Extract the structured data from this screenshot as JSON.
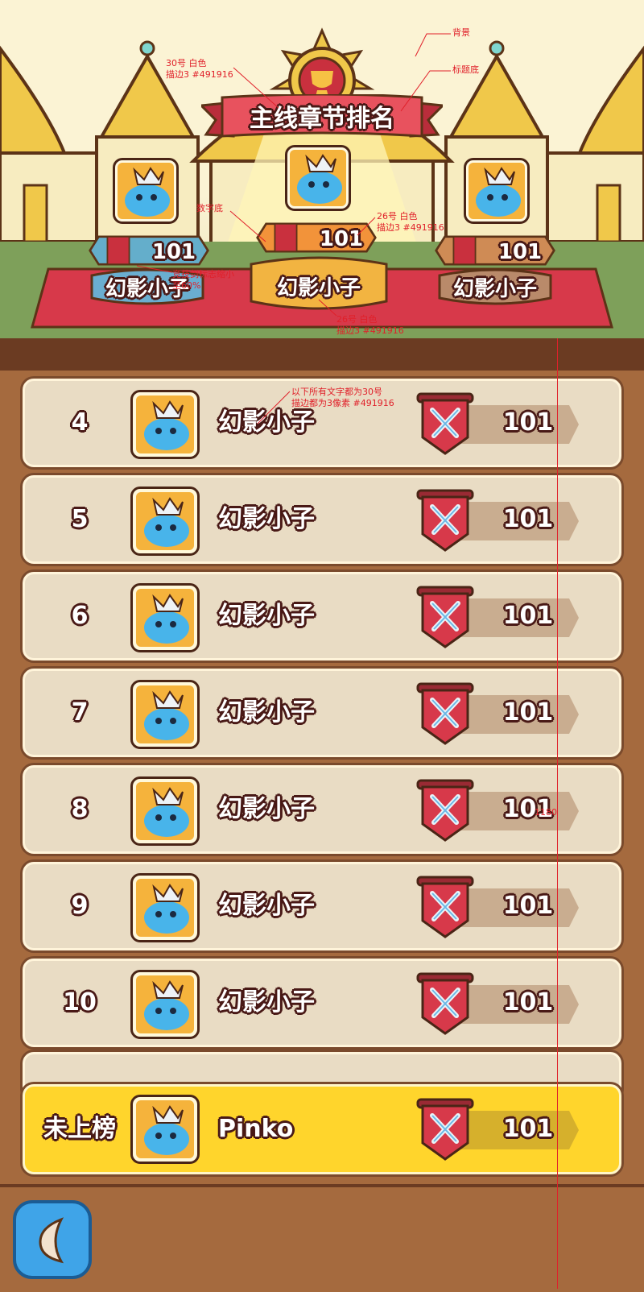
{
  "title": "主线章节排名",
  "annotations": {
    "background": "背景",
    "title_base": "标题底",
    "title_font": "30号 白色\n描边3 #491916",
    "number_base": "数字底",
    "score_font": "26号 白色\n描边3 #491916",
    "sword_scale": "竞技剑标志缩小\n至60%",
    "name_font": "26号 白色\n描边3 #491916",
    "list_font": "以下所有文字都为30号\n描边都为3像素 #491916",
    "height_marker": "1180"
  },
  "podium": [
    {
      "place": "2",
      "name": "幻影小子",
      "score": "101"
    },
    {
      "place": "1",
      "name": "幻影小子",
      "score": "101"
    },
    {
      "place": "3",
      "name": "幻影小子",
      "score": "101"
    }
  ],
  "rows": [
    {
      "rank": "4",
      "name": "幻影小子",
      "score": "101"
    },
    {
      "rank": "5",
      "name": "幻影小子",
      "score": "101"
    },
    {
      "rank": "6",
      "name": "幻影小子",
      "score": "101"
    },
    {
      "rank": "7",
      "name": "幻影小子",
      "score": "101"
    },
    {
      "rank": "8",
      "name": "幻影小子",
      "score": "101"
    },
    {
      "rank": "9",
      "name": "幻影小子",
      "score": "101"
    },
    {
      "rank": "10",
      "name": "幻影小子",
      "score": "101"
    }
  ],
  "self": {
    "rank": "未上榜",
    "name": "Pinko",
    "score": "101"
  },
  "colors": {
    "stroke": "#491916",
    "gold": "#f2b441",
    "silver_blue": "#64aecb",
    "bronze": "#cf8b55",
    "row_bg": "#e9dcc4",
    "self_bg": "#ffd52c",
    "carpet": "#d7394a",
    "back_button": "#3fa4e8"
  }
}
